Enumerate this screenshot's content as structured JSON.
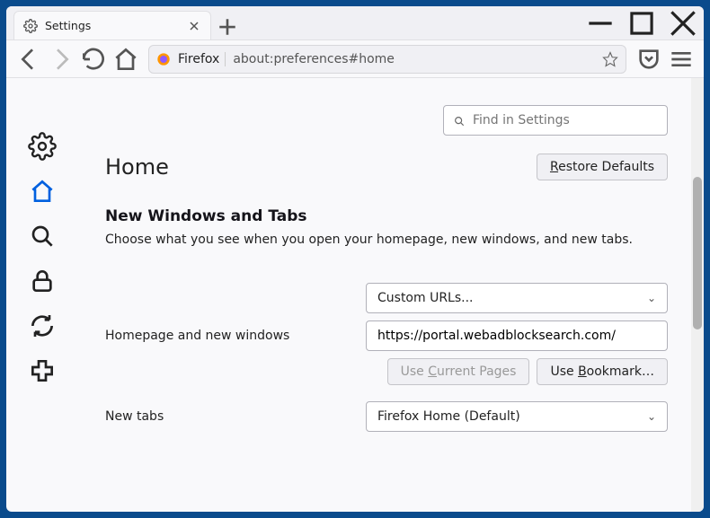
{
  "tab": {
    "title": "Settings"
  },
  "toolbar": {
    "prefix": "Firefox",
    "url": "about:preferences#home"
  },
  "search": {
    "placeholder": "Find in Settings"
  },
  "page": {
    "heading": "Home",
    "restore": "Restore Defaults",
    "section_title": "New Windows and Tabs",
    "section_desc": "Choose what you see when you open your homepage, new windows, and new tabs.",
    "homepage_label": "Homepage and new windows",
    "homepage_select": "Custom URLs...",
    "homepage_value": "https://portal.webadblocksearch.com/",
    "use_current": "Use Current Pages",
    "use_bookmark": "Use Bookmark…",
    "newtabs_label": "New tabs",
    "newtabs_select": "Firefox Home (Default)"
  }
}
